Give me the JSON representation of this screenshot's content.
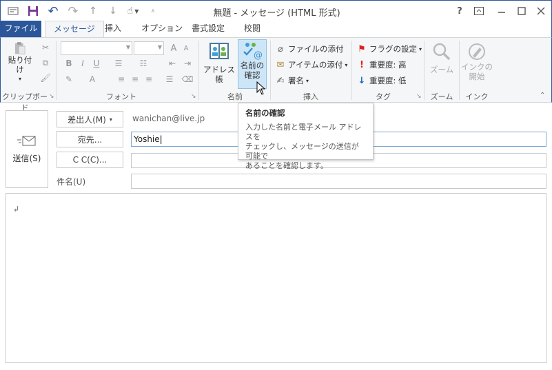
{
  "window": {
    "title": "無題 - メッセージ (HTML 形式)",
    "help": "?",
    "restore": "⧈",
    "minimize": "—",
    "maximize": "☐",
    "close": "✕"
  },
  "quick_access": [
    "save",
    "undo",
    "redo",
    "up",
    "down",
    "touch-mode",
    "customize"
  ],
  "tabs": [
    {
      "label": "ファイル"
    },
    {
      "label": "メッセージ"
    },
    {
      "label": "挿入"
    },
    {
      "label": "オプション"
    },
    {
      "label": "書式設定"
    },
    {
      "label": "校閲"
    }
  ],
  "ribbon": {
    "clipboard": {
      "paste": "貼り付け",
      "label": "クリップボード"
    },
    "font": {
      "bold": "B",
      "italic": "I",
      "underline": "U",
      "grow": "A",
      "shrink": "A",
      "label": "フォント"
    },
    "names": {
      "address_book": "アドレス帳",
      "check_names_1": "名前の",
      "check_names_2": "確認",
      "label": "名前"
    },
    "insert": {
      "attach_file": "ファイルの添付",
      "attach_item": "アイテムの添付",
      "signature": "署名",
      "label": "挿入"
    },
    "tags": {
      "follow_up": "フラグの設定",
      "high": "重要度: 高",
      "low": "重要度: 低",
      "label": "タグ"
    },
    "zoom": {
      "zoom_btn": "ズーム",
      "label": "ズーム"
    },
    "ink": {
      "start_1": "インクの",
      "start_2": "開始",
      "label": "インク"
    }
  },
  "compose": {
    "send": "送信(S)",
    "from_btn": "差出人(M)",
    "from_value": "wanichan@live.jp",
    "to_btn": "宛先...",
    "to_value": "Yoshie",
    "cc_btn": "C C(C)...",
    "cc_value": "",
    "subject_label": "件名(U)",
    "subject_value": "",
    "body_mark": "↲"
  },
  "tooltip": {
    "title": "名前の確認",
    "line1": "入力した名前と電子メール アドレスを",
    "line2": "チェックし、メッセージの送信が可能で",
    "line3": "あることを確認します。"
  },
  "colors": {
    "accent": "#2b579a",
    "ribbon_bg": "#f5f6f7",
    "hover": "#cde6f7",
    "flag": "#e02020",
    "low": "#1e64c8"
  }
}
